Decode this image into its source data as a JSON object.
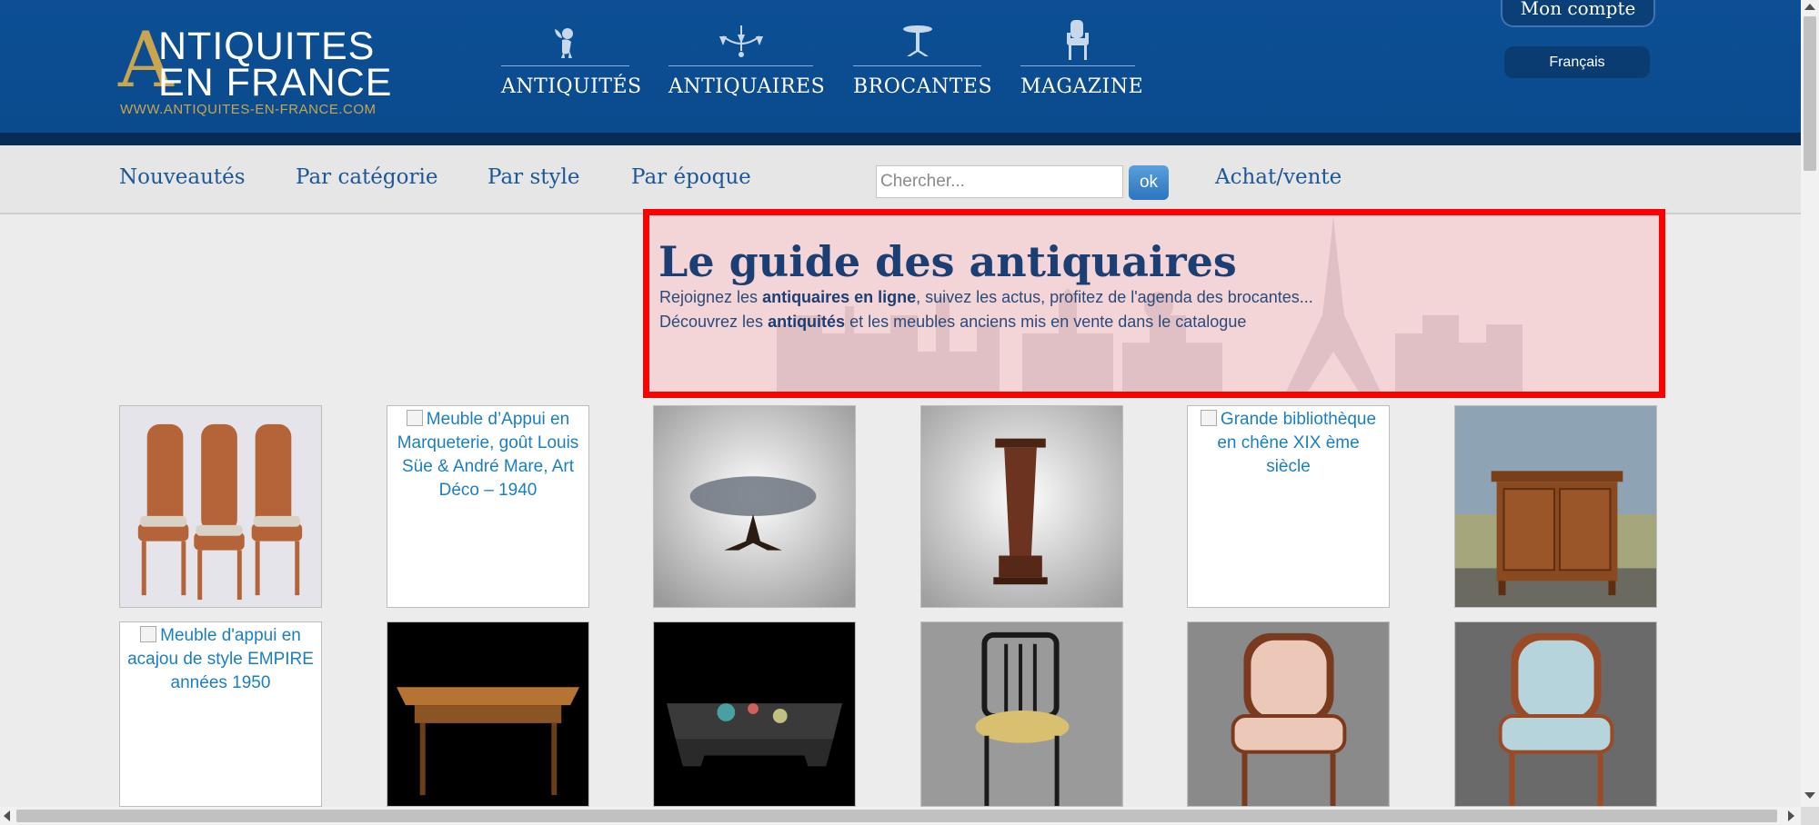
{
  "header": {
    "logo": {
      "initial": "A",
      "line1": "NTIQUITES",
      "line2": "EN FRANCE",
      "url": "WWW.ANTIQUITES-EN-FRANCE.COM"
    },
    "main_nav": [
      {
        "label": "ANTIQUITÉS",
        "icon": "cherub-icon"
      },
      {
        "label": "ANTIQUAIRES",
        "icon": "chandelier-icon"
      },
      {
        "label": "BROCANTES",
        "icon": "pedestal-table-icon"
      },
      {
        "label": "MAGAZINE",
        "icon": "armchair-icon"
      }
    ],
    "account_label": "Mon compte",
    "language": "Français"
  },
  "subnav": {
    "links": [
      "Nouveautés",
      "Par catégorie",
      "Par style",
      "Par époque"
    ],
    "search_placeholder": "Chercher...",
    "search_button": "ok",
    "sell_link": "Achat/vente"
  },
  "hero": {
    "title": "Le guide des antiquaires",
    "line1": {
      "before": "Rejoignez les ",
      "bold": "antiquaires en ligne",
      "after": ", suivez les actus, profitez de l'agenda des brocantes..."
    },
    "line2": {
      "before": "Découvrez les ",
      "bold": "antiquités",
      "after": " et les meubles anciens mis en vente dans le catalogue"
    }
  },
  "products": {
    "alt_texts": [
      "Meuble d’Appui en Marqueterie, goût Louis Süe & André Mare, Art Déco – 1940",
      "Grande bibliothèque en chêne XIX ème siècle",
      "Meuble d'appui en acajou de style EMPIRE années 1950"
    ]
  },
  "colors": {
    "header_blue": "#0d4f94",
    "gold": "#c9a64e",
    "link_blue": "#1d5795",
    "highlight_border": "#ff0000"
  }
}
